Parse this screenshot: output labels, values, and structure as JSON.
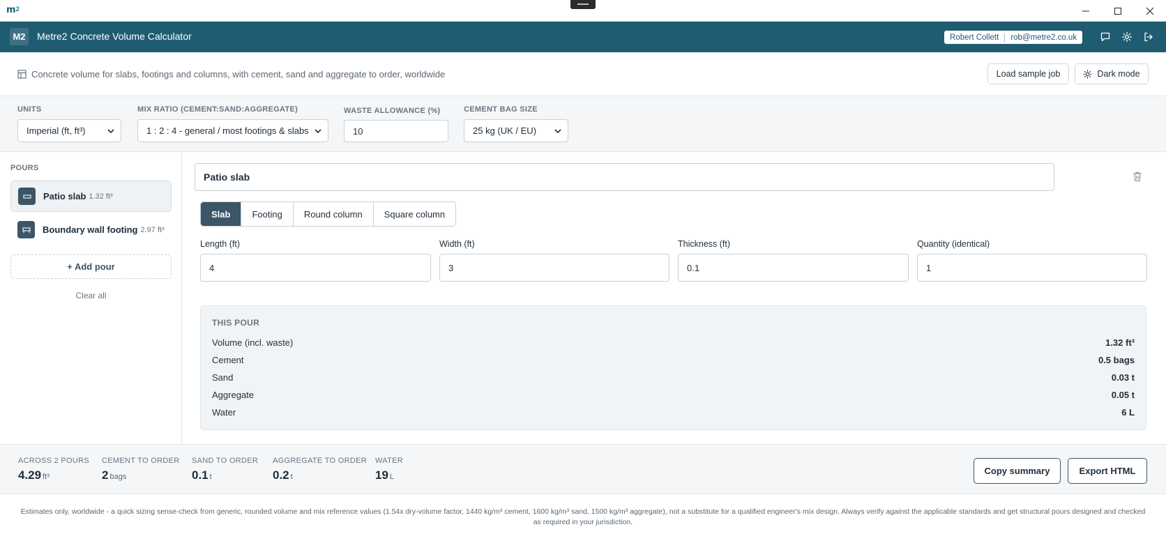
{
  "window": {
    "app_mark": "m",
    "app_mark_sub": "2"
  },
  "header": {
    "logo": "M2",
    "title": "Metre2 Concrete Volume Calculator",
    "user_name": "Robert Collett",
    "user_email": "rob@metre2.co.uk"
  },
  "intro": {
    "description": "Concrete volume for slabs, footings and columns, with cement, sand and aggregate to order, worldwide",
    "load_sample_label": "Load sample job",
    "dark_mode_label": "Dark mode"
  },
  "settings": {
    "units_label": "UNITS",
    "units_value": "Imperial (ft, ft³)",
    "mix_label": "MIX RATIO (CEMENT:SAND:AGGREGATE)",
    "mix_value": "1 : 2 : 4 - general / most footings & slabs",
    "waste_label": "WASTE ALLOWANCE (%)",
    "waste_value": "10",
    "bag_label": "CEMENT BAG SIZE",
    "bag_value": "25 kg (UK / EU)"
  },
  "sidebar": {
    "pours_label": "POURS",
    "items": [
      {
        "name": "Patio slab",
        "volume": "1.32 ft³"
      },
      {
        "name": "Boundary wall footing",
        "volume": "2.97 ft³"
      }
    ],
    "add_pour_label": "+ Add pour",
    "clear_all_label": "Clear all"
  },
  "pour": {
    "name": "Patio slab",
    "tabs": [
      "Slab",
      "Footing",
      "Round column",
      "Square column"
    ],
    "active_tab": "Slab",
    "length_label": "Length (ft)",
    "length_value": "4",
    "width_label": "Width (ft)",
    "width_value": "3",
    "thickness_label": "Thickness (ft)",
    "thickness_value": "0.1",
    "quantity_label": "Quantity (identical)",
    "quantity_value": "1"
  },
  "this_pour": {
    "title": "THIS POUR",
    "rows": [
      {
        "label": "Volume (incl. waste)",
        "value": "1.32 ft³"
      },
      {
        "label": "Cement",
        "value": "0.5 bags"
      },
      {
        "label": "Sand",
        "value": "0.03 t"
      },
      {
        "label": "Aggregate",
        "value": "0.05 t"
      },
      {
        "label": "Water",
        "value": "6 L"
      }
    ]
  },
  "totals": {
    "across_label": "ACROSS 2 POURS",
    "across_value": "4.29",
    "across_unit": "ft³",
    "cement_label": "CEMENT TO ORDER",
    "cement_value": "2",
    "cement_unit": "bags",
    "sand_label": "SAND TO ORDER",
    "sand_value": "0.1",
    "sand_unit": "t",
    "aggregate_label": "AGGREGATE TO ORDER",
    "aggregate_value": "0.2",
    "aggregate_unit": "t",
    "water_label": "WATER",
    "water_value": "19",
    "water_unit": "L",
    "copy_label": "Copy summary",
    "export_label": "Export HTML"
  },
  "footer": {
    "disclaimer": "Estimates only, worldwide - a quick sizing sense-check from generic, rounded volume and mix reference values (1.54x dry-volume factor, 1440 kg/m³ cement, 1600 kg/m³ sand, 1500 kg/m³ aggregate), not a substitute for a qualified engineer's mix design. Always verify against the applicable standards and get structural pours designed and checked as required in your jurisdiction."
  }
}
